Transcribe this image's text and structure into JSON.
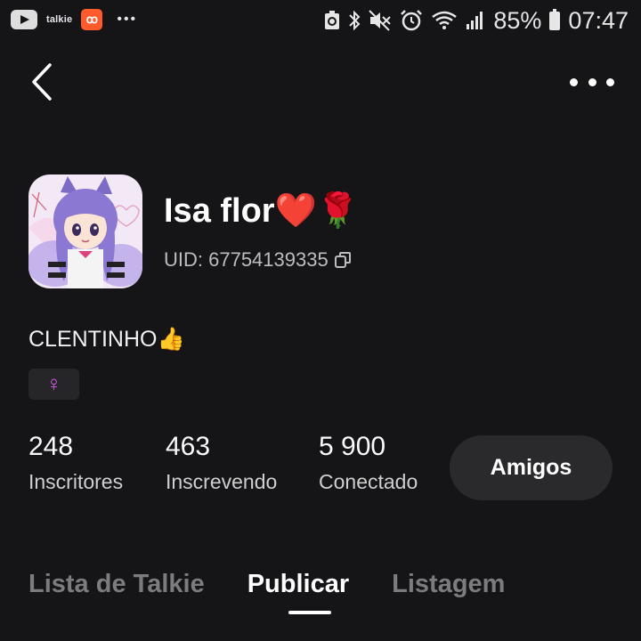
{
  "status_bar": {
    "left_icons": [
      "youtube-icon",
      "talkie-icon",
      "kwai-icon",
      "more-notifications-icon"
    ],
    "talkie_label": "talkie",
    "right_icons": [
      "data-saver-icon",
      "bluetooth-icon",
      "mute-icon",
      "alarm-icon",
      "wifi-icon",
      "signal-icon",
      "battery-charging-icon"
    ],
    "battery": "85%",
    "time": "07:47"
  },
  "nav": {
    "back_icon": "chevron-left-icon",
    "more_icon": "more-horizontal-icon"
  },
  "profile": {
    "name": "Isa flor❤️🌹",
    "uid": "UID: 67754139335",
    "bio": "CLENTINHO👍",
    "gender_symbol": "♀",
    "gender_color": "#d45be6"
  },
  "stats": [
    {
      "value": "248",
      "label": "Inscritores"
    },
    {
      "value": "463",
      "label": "Inscrevendo"
    },
    {
      "value": "5 900",
      "label": "Conectado"
    }
  ],
  "friends_button": "Amigos",
  "tabs": [
    {
      "label": "Lista de Talkie",
      "active": false
    },
    {
      "label": "Publicar",
      "active": true
    },
    {
      "label": "Listagem",
      "active": false
    }
  ],
  "colors": {
    "background": "#151417",
    "button_bg": "#2a2a2d",
    "inactive_tab": "#7c7c7f"
  }
}
